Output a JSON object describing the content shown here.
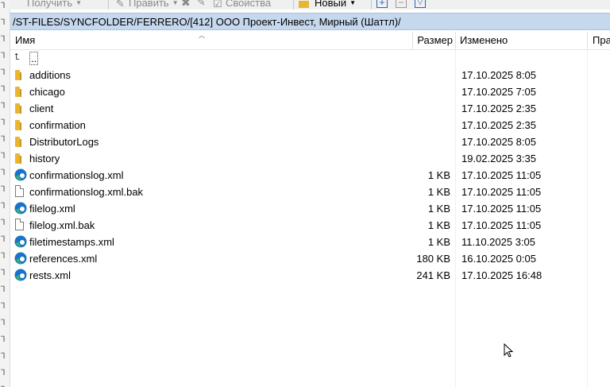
{
  "toolbar": {
    "get_label": "Получить",
    "edit_label": "Править",
    "properties_label": "Свойства",
    "new_label": "Новый"
  },
  "path": "/ST-FILES/SYNCFOLDER/FERRERO/[412] ООО Проект-Инвест, Мирный (Шаттл)/",
  "columns": {
    "name": "Имя",
    "size": "Размер",
    "modified": "Изменено",
    "rights": "Пра"
  },
  "parent_dir": "..",
  "rows": [
    {
      "name": "additions",
      "type": "folder",
      "size": "",
      "modified": "17.10.2025 8:05"
    },
    {
      "name": "chicago",
      "type": "folder",
      "size": "",
      "modified": "17.10.2025 7:05"
    },
    {
      "name": "client",
      "type": "folder",
      "size": "",
      "modified": "17.10.2025 2:35"
    },
    {
      "name": "confirmation",
      "type": "folder",
      "size": "",
      "modified": "17.10.2025 2:35"
    },
    {
      "name": "DistributorLogs",
      "type": "folder",
      "size": "",
      "modified": "17.10.2025 8:05"
    },
    {
      "name": "history",
      "type": "folder",
      "size": "",
      "modified": "19.02.2025 3:35"
    },
    {
      "name": "confirmationslog.xml",
      "type": "edge",
      "size": "1 KB",
      "modified": "17.10.2025 11:05"
    },
    {
      "name": "confirmationslog.xml.bak",
      "type": "doc",
      "size": "1 KB",
      "modified": "17.10.2025 11:05"
    },
    {
      "name": "filelog.xml",
      "type": "edge",
      "size": "1 KB",
      "modified": "17.10.2025 11:05"
    },
    {
      "name": "filelog.xml.bak",
      "type": "doc",
      "size": "1 KB",
      "modified": "17.10.2025 11:05"
    },
    {
      "name": "filetimestamps.xml",
      "type": "edge",
      "size": "1 KB",
      "modified": "11.10.2025 3:05"
    },
    {
      "name": "references.xml",
      "type": "edge",
      "size": "180 KB",
      "modified": "16.10.2025 0:05"
    },
    {
      "name": "rests.xml",
      "type": "edge",
      "size": "241 KB",
      "modified": "17.10.2025 16:48"
    }
  ],
  "colors": {
    "pathbar": "#c6d8ee",
    "folder": "#e8b631",
    "edge_blue": "#1a73c9",
    "edge_green": "#35b56a"
  }
}
